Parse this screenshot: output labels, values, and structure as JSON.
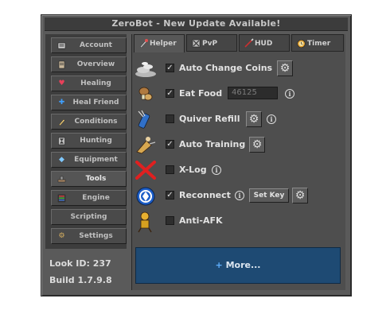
{
  "window": {
    "title": "ZeroBot - New Update Available!"
  },
  "sidebar": {
    "items": [
      {
        "label": "Account",
        "icon": "account-icon"
      },
      {
        "label": "Overview",
        "icon": "book-icon"
      },
      {
        "label": "Healing",
        "icon": "heart-icon"
      },
      {
        "label": "Heal Friend",
        "icon": "plus-icon"
      },
      {
        "label": "Conditions",
        "icon": "conditions-icon"
      },
      {
        "label": "Hunting",
        "icon": "hourglass-icon"
      },
      {
        "label": "Equipment",
        "icon": "diamond-icon"
      },
      {
        "label": "Tools",
        "icon": "tools-icon"
      },
      {
        "label": "Engine",
        "icon": "engine-icon"
      },
      {
        "label": "Scripting",
        "icon": ""
      },
      {
        "label": "Settings",
        "icon": "gear-icon"
      }
    ],
    "active": "Tools",
    "look_id": "Look ID: 237",
    "build": "Build 1.7.9.8"
  },
  "tabs": [
    {
      "label": "Helper",
      "icon": "helper-icon",
      "active": true
    },
    {
      "label": "PvP",
      "icon": "pvp-icon",
      "active": false
    },
    {
      "label": "HUD",
      "icon": "sword-icon",
      "active": false
    },
    {
      "label": "Timer",
      "icon": "timer-icon",
      "active": false
    }
  ],
  "options": [
    {
      "label": "Auto Change Coins",
      "checked": true,
      "icon": "coins-icon"
    },
    {
      "label": "Eat Food",
      "checked": true,
      "icon": "food-icon",
      "field_value": "46125"
    },
    {
      "label": "Quiver Refill",
      "checked": false,
      "icon": "quiver-icon"
    },
    {
      "label": "Auto Training",
      "checked": true,
      "icon": "training-icon"
    },
    {
      "label": "X-Log",
      "checked": false,
      "icon": "x-log-icon"
    },
    {
      "label": "Reconnect",
      "checked": true,
      "icon": "reconnect-icon",
      "button_label": "Set Key"
    },
    {
      "label": "Anti-AFK",
      "checked": false,
      "icon": "anti-afk-icon"
    }
  ],
  "more": {
    "plus": "+",
    "label": "More..."
  },
  "glyphs": {
    "check": "✓",
    "gear": "⚙",
    "info": "i"
  },
  "colors": {
    "window_bg": "#5a5a5a",
    "panel_bg": "#4e4e4e",
    "more_bg": "#1e4a73",
    "text": "#e2e2e2"
  }
}
